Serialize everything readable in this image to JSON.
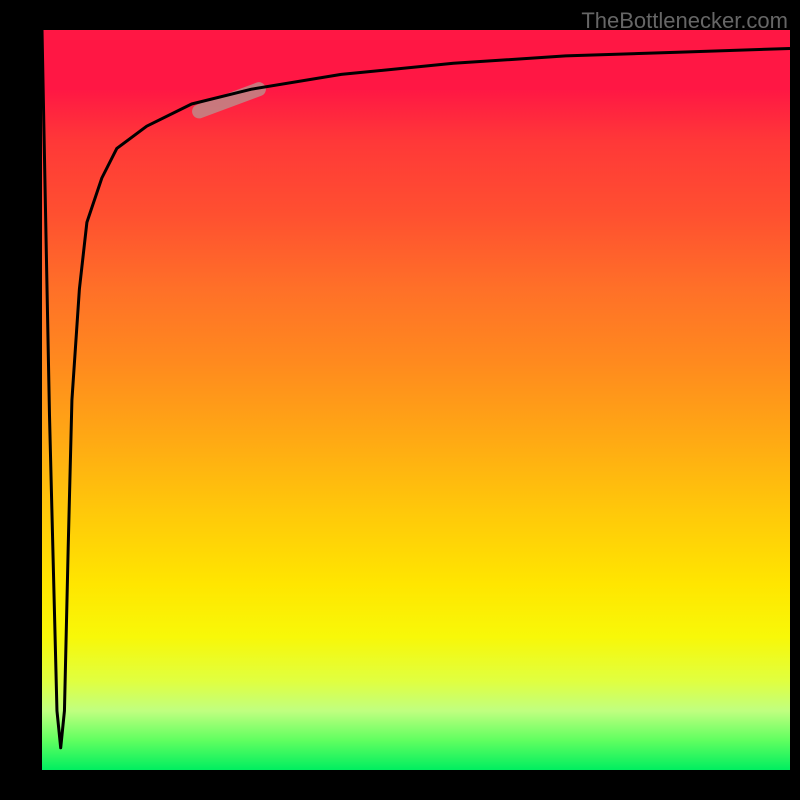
{
  "watermark": "TheBottlenecker.com",
  "chart_data": {
    "type": "line",
    "title": "",
    "xlabel": "",
    "ylabel": "",
    "xlim": [
      0,
      100
    ],
    "ylim": [
      0,
      100
    ],
    "series": [
      {
        "name": "curve",
        "x": [
          0,
          1,
          2,
          2.5,
          3,
          3.5,
          4,
          5,
          6,
          8,
          10,
          14,
          20,
          28,
          40,
          55,
          70,
          85,
          100
        ],
        "y": [
          100,
          48,
          8,
          3,
          8,
          30,
          50,
          65,
          74,
          80,
          84,
          87,
          90,
          92,
          94,
          95.5,
          96.5,
          97,
          97.5
        ]
      }
    ],
    "highlight_segment": {
      "x_start": 21,
      "x_end": 29,
      "y_start": 89,
      "y_end": 92,
      "color": "#c08888"
    }
  }
}
